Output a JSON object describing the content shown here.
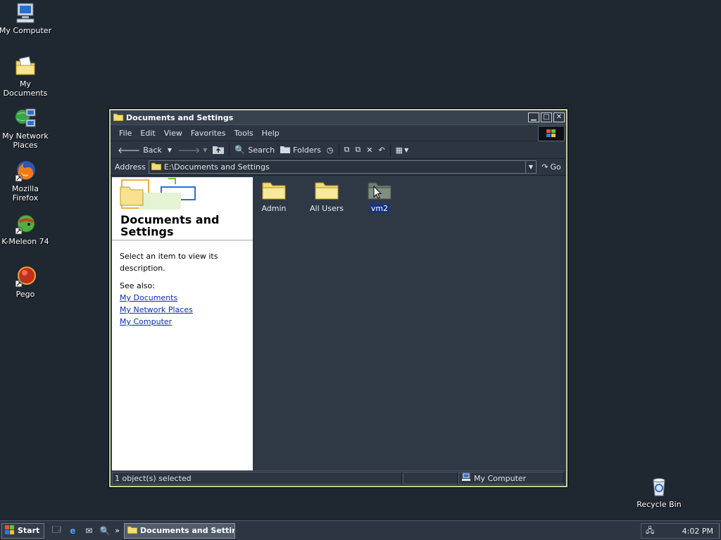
{
  "desktop": {
    "icons": [
      {
        "label": "My Computer",
        "icon": "computer-icon"
      },
      {
        "label": "My Documents",
        "icon": "documents-icon"
      },
      {
        "label": "My Network Places",
        "icon": "network-icon"
      },
      {
        "label": "Mozilla Firefox",
        "icon": "firefox-icon"
      },
      {
        "label": "K-Meleon 74",
        "icon": "kmeleon-icon"
      },
      {
        "label": "Pego",
        "icon": "pego-icon"
      },
      {
        "label": "Recycle Bin",
        "icon": "recycle-bin-icon"
      }
    ]
  },
  "window": {
    "title": "Documents and Settings",
    "menu": [
      "File",
      "Edit",
      "View",
      "Favorites",
      "Tools",
      "Help"
    ],
    "toolbar": {
      "back": "Back",
      "search": "Search",
      "folders": "Folders"
    },
    "address": {
      "label": "Address",
      "value": "E:\\Documents and Settings",
      "go": "Go"
    },
    "taskpane": {
      "title": "Documents and Settings",
      "description": "Select an item to view its description.",
      "see_also": "See also:",
      "links": [
        "My Documents",
        "My Network Places",
        "My Computer"
      ]
    },
    "files": [
      {
        "name": "Admin",
        "selected": false
      },
      {
        "name": "All Users",
        "selected": false
      },
      {
        "name": "vm2",
        "selected": true
      }
    ],
    "status": {
      "selection": "1 object(s) selected",
      "zone": "My Computer"
    }
  },
  "taskbar": {
    "start": "Start",
    "task": "Documents and Settin...",
    "clock": "4:02 PM",
    "chevron": "»"
  },
  "colors": {
    "desktop_bg": "#1f2731",
    "window_border": "#c8cf9a",
    "selection": "#16357a",
    "link": "#0a2ea8",
    "folder": "#f2dc74"
  }
}
